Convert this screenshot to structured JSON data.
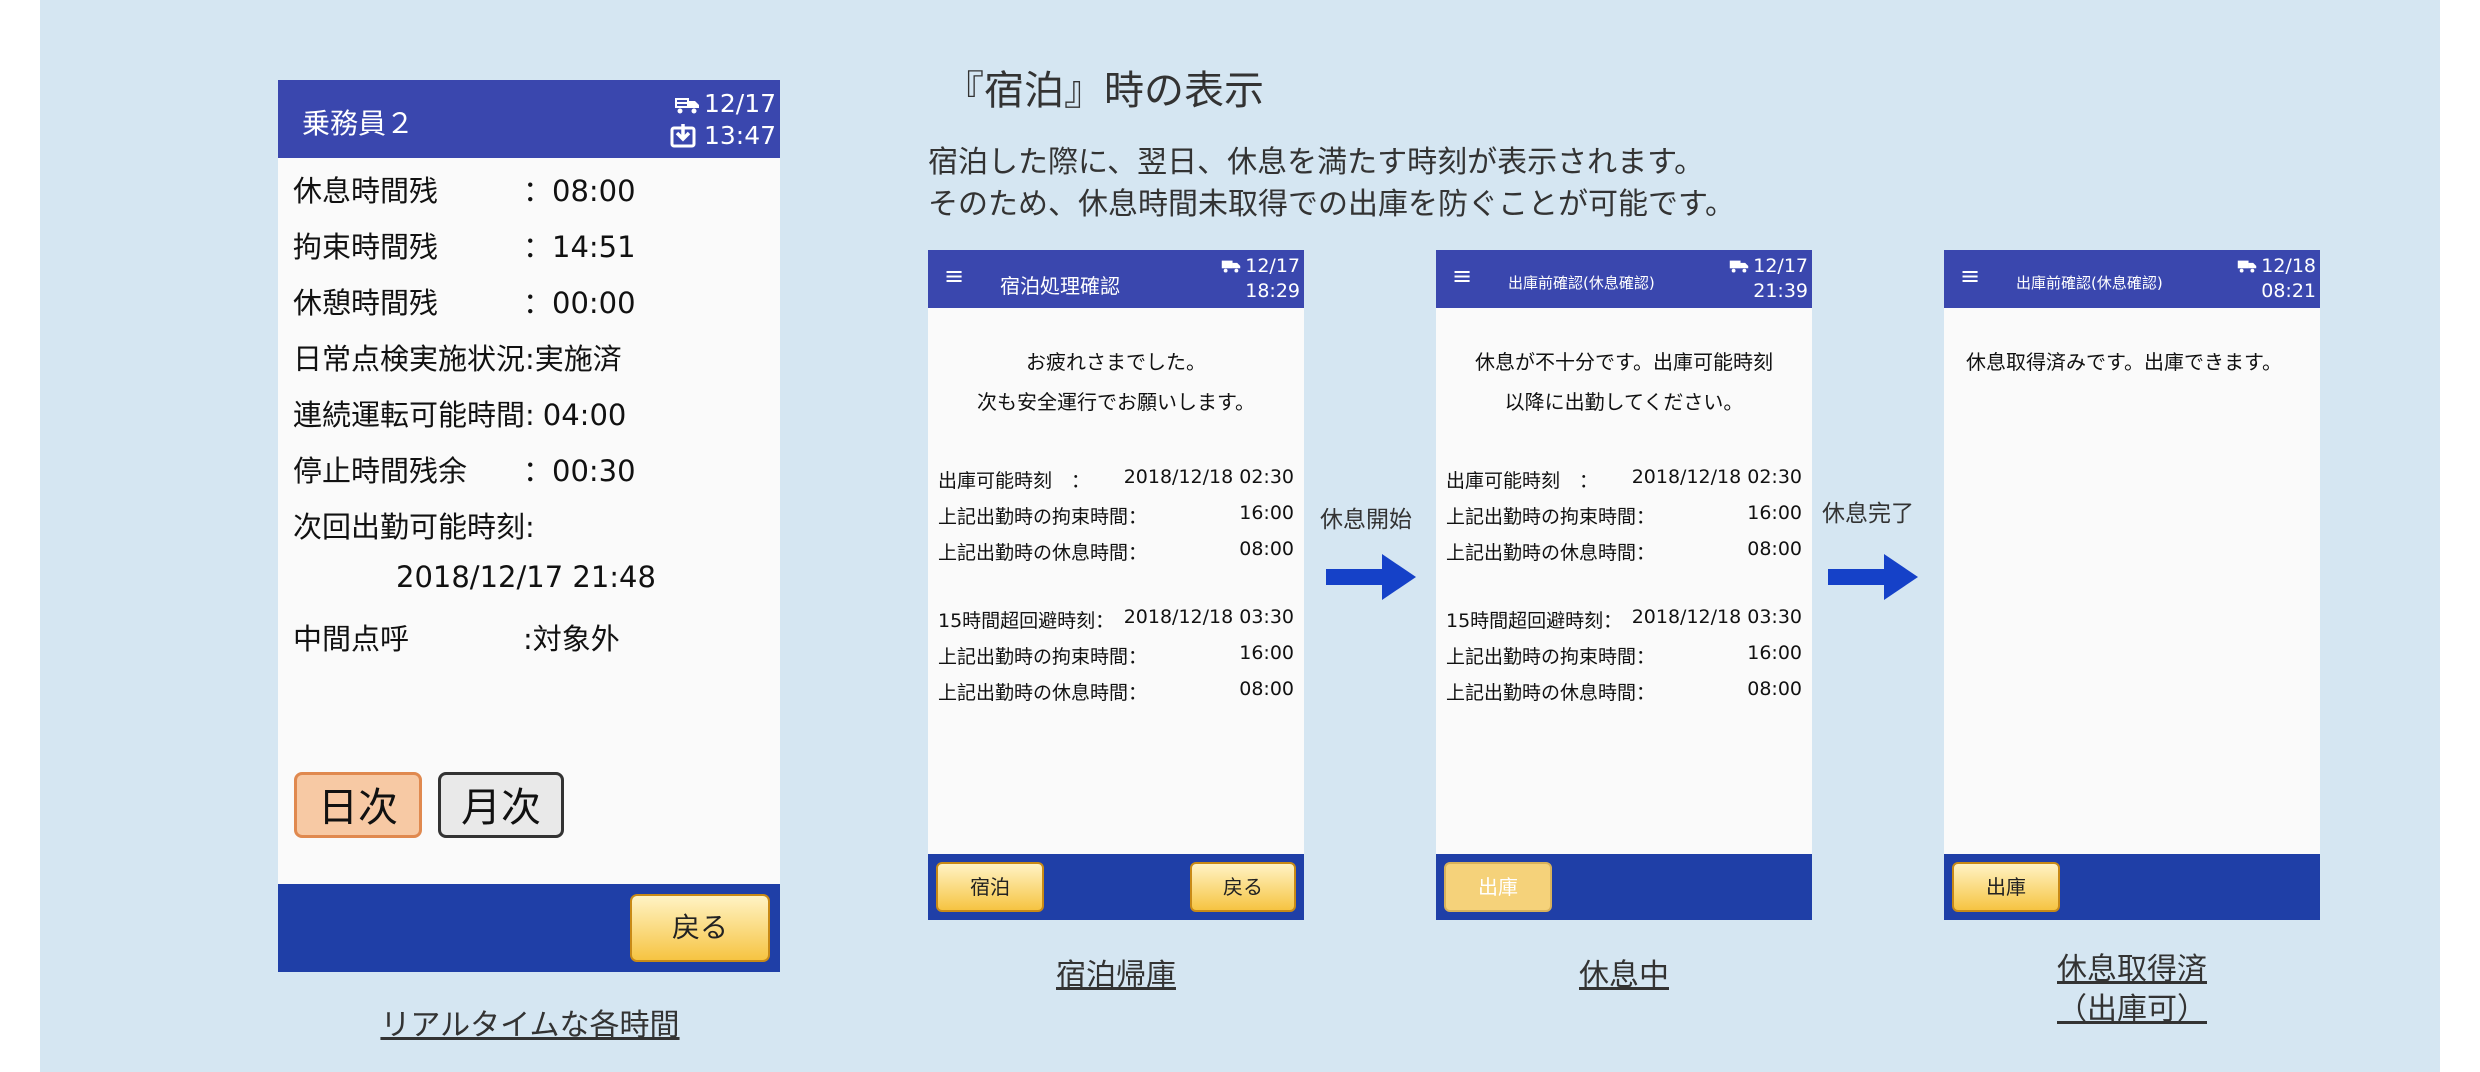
{
  "realtime_screen": {
    "header_title": "乗務員２",
    "header_date": "12/17",
    "header_time": "13:47",
    "rows": [
      {
        "label": "休息時間残",
        "value": "：08:00"
      },
      {
        "label": "拘束時間残",
        "value": "：14:51"
      },
      {
        "label": "休憩時間残",
        "value": "：00:00"
      },
      {
        "label": "日常点検実施状況:",
        "value": "実施済"
      },
      {
        "label": "連続運転可能時間:",
        "value": "04:00"
      },
      {
        "label": "停止時間残余",
        "value": "：00:30"
      },
      {
        "label": "次回出勤可能時刻:",
        "value": ""
      },
      {
        "label": "",
        "value": "2018/12/17 21:48"
      },
      {
        "label": "中間点呼",
        "value": ":対象外"
      }
    ],
    "daily_button": "日次",
    "monthly_button": "月次",
    "back_button": "戻る",
    "caption": "リアルタイムな各時間"
  },
  "section": {
    "title": "『宿泊』時の表示",
    "description_line1": "宿泊した際に、翌日、休息を満たす時刻が表示されます。",
    "description_line2": "そのため、休息時間未取得での出庫を防ぐことが可能です。"
  },
  "screen_stay": {
    "menu_icon": "≡",
    "title": "宿泊処理確認",
    "date": "12/17",
    "time": "18:29",
    "message_line1": "お疲れさまでした。",
    "message_line2": "次も安全運行でお願いします。",
    "rows": [
      {
        "left": "出庫可能時刻　：",
        "right": "2018/12/18 02:30"
      },
      {
        "left": "上記出勤時の拘束時間：",
        "right": "16:00"
      },
      {
        "left": "上記出勤時の休息時間：",
        "right": "08:00"
      },
      {
        "left": "15時間超回避時刻：",
        "right": "2018/12/18 03:30"
      },
      {
        "left": "上記出勤時の拘束時間：",
        "right": "16:00"
      },
      {
        "left": "上記出勤時の休息時間：",
        "right": "08:00"
      }
    ],
    "btn_left": "宿泊",
    "btn_right": "戻る",
    "caption": "宿泊帰庫"
  },
  "arrow1_label": "休息開始",
  "screen_resting": {
    "menu_icon": "≡",
    "title": "出庫前確認(休息確認)",
    "date": "12/17",
    "time": "21:39",
    "message_line1": "休息が不十分です。出庫可能時刻",
    "message_line2": "以降に出勤してください。",
    "rows": [
      {
        "left": "出庫可能時刻　：",
        "right": "2018/12/18 02:30"
      },
      {
        "left": "上記出勤時の拘束時間：",
        "right": "16:00"
      },
      {
        "left": "上記出勤時の休息時間：",
        "right": "08:00"
      },
      {
        "left": "15時間超回避時刻：",
        "right": "2018/12/18 03:30"
      },
      {
        "left": "上記出勤時の拘束時間：",
        "right": "16:00"
      },
      {
        "left": "上記出勤時の休息時間：",
        "right": "08:00"
      }
    ],
    "btn_depart": "出庫",
    "caption": "休息中"
  },
  "arrow2_label": "休息完了",
  "screen_done": {
    "menu_icon": "≡",
    "title": "出庫前確認(休息確認)",
    "date": "12/18",
    "time": "08:21",
    "message": "休息取得済みです。出庫できます。",
    "btn_depart": "出庫",
    "caption_line1": "休息取得済",
    "caption_line2": "（出庫可）"
  },
  "colors": {
    "header_blue": "#3a47ae",
    "footer_blue": "#1f3fa7",
    "arrow_blue": "#1541c8",
    "background": "#d5e6f2",
    "button_gold": "#f6c442"
  },
  "icons": [
    "truck-icon",
    "download-icon",
    "menu-icon",
    "right-arrow-icon"
  ]
}
